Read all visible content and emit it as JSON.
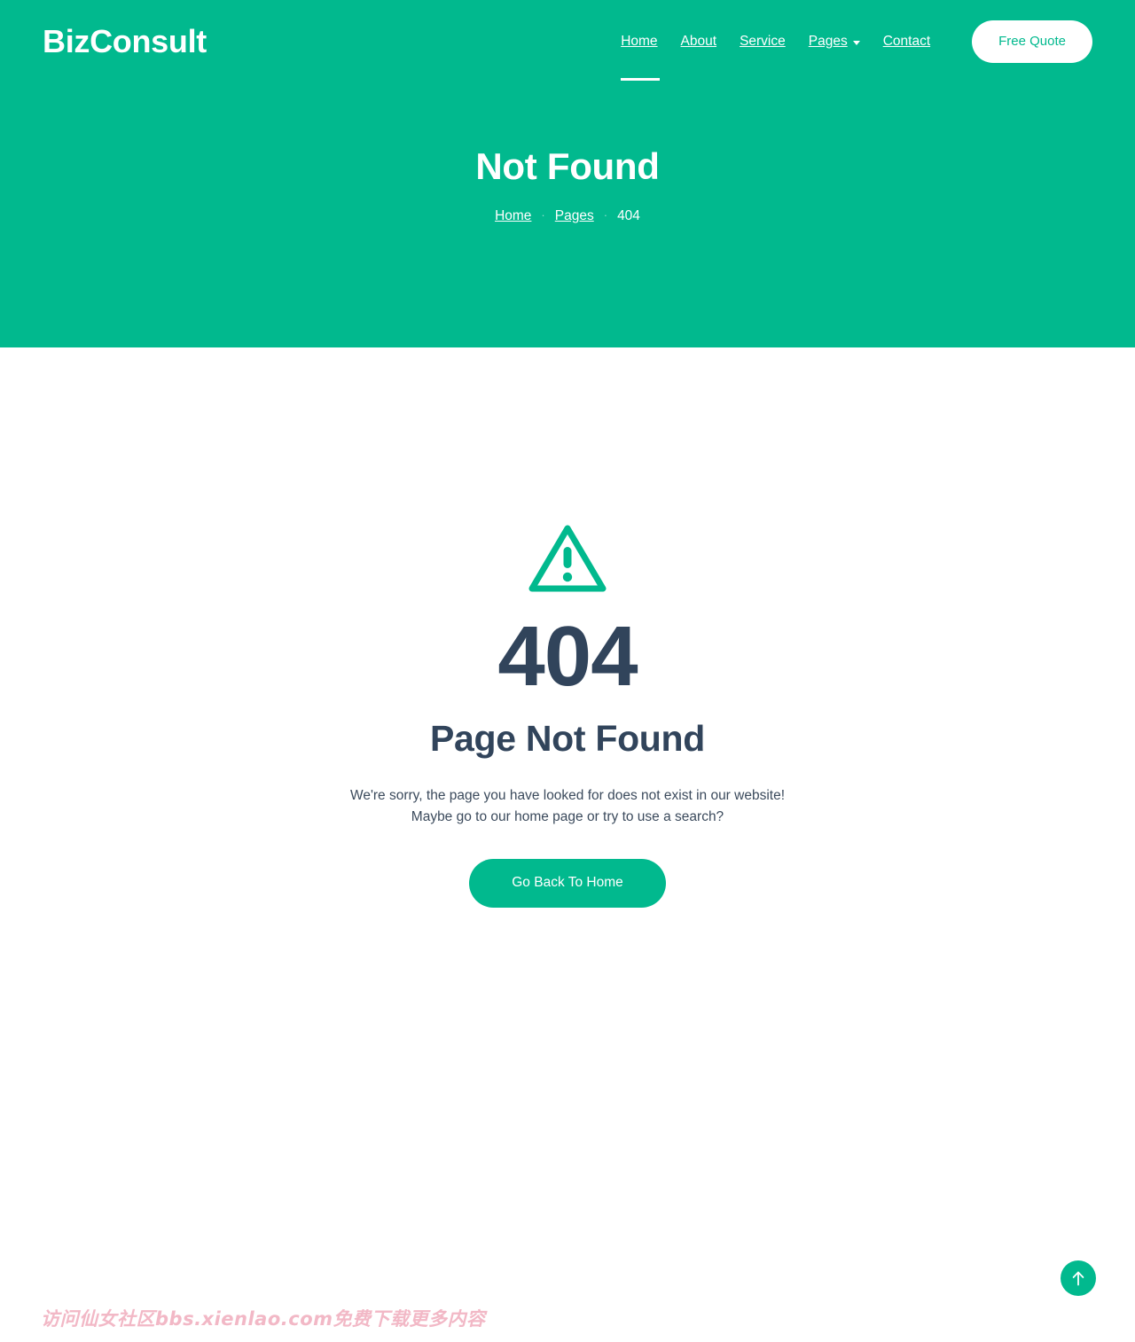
{
  "header": {
    "brand": "BizConsult",
    "nav": [
      {
        "label": "Home",
        "active": true,
        "has_dropdown": false
      },
      {
        "label": "About",
        "active": false,
        "has_dropdown": false
      },
      {
        "label": "Service",
        "active": false,
        "has_dropdown": false
      },
      {
        "label": "Pages",
        "active": false,
        "has_dropdown": true
      },
      {
        "label": "Contact",
        "active": false,
        "has_dropdown": false
      }
    ],
    "cta_label": "Free Quote"
  },
  "hero": {
    "title": "Not Found",
    "breadcrumb": [
      "Home",
      "Pages",
      "404"
    ],
    "separator": "·"
  },
  "main": {
    "icon": "warning-triangle-icon",
    "error_code": "404",
    "heading": "Page Not Found",
    "message_line1": "We're sorry, the page you have looked for does not exist in our website!",
    "message_line2": "Maybe go to our home page or try to use a search?",
    "home_button": "Go Back To Home"
  },
  "scroll_top": {
    "icon": "arrow-up-icon"
  },
  "watermark": {
    "text": "访问仙女社区bbs.xienlao.com免费下载更多内容"
  },
  "colors": {
    "brand_green": "#01b98e",
    "dark_navy": "#31445b",
    "white": "#ffffff",
    "watermark_pink": "#f2b8c6"
  }
}
